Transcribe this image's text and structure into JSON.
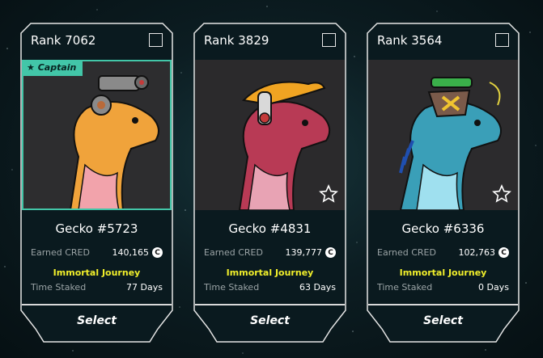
{
  "labels": {
    "earned_cred": "Earned CRED",
    "time_staked": "Time Staked",
    "select": "Select",
    "cred_icon": "C"
  },
  "colors": {
    "accent": "#42c6a8",
    "journey": "#f1ef2b",
    "card_bg": "#0a1a1f",
    "border": "#e6e6e6"
  },
  "cards": [
    {
      "rank": "Rank 7062",
      "badge": "Captain",
      "name": "Gecko #5723",
      "earned_cred": "140,165",
      "journey": "Immortal Journey",
      "time_staked": "77 Days",
      "selected": true,
      "has_star": false,
      "palette": {
        "bg": "#2d2d2f",
        "head": "#f0a33b",
        "belly": "#f2a3ab",
        "accessory": "#8a8a8a"
      }
    },
    {
      "rank": "Rank 3829",
      "name": "Gecko #4831",
      "earned_cred": "139,777",
      "journey": "Immortal Journey",
      "time_staked": "63 Days",
      "selected": false,
      "has_star": true,
      "palette": {
        "bg": "#2b2a2c",
        "head": "#b83a55",
        "belly": "#e8a3b4",
        "accessory": "#f0a422"
      }
    },
    {
      "rank": "Rank 3564",
      "name": "Gecko #6336",
      "earned_cred": "102,763",
      "journey": "Immortal Journey",
      "time_staked": "0 Days",
      "selected": false,
      "has_star": true,
      "palette": {
        "bg": "#2c2b2d",
        "head": "#3a9fb8",
        "belly": "#9fe0ef",
        "accessory": "#7a5a4a"
      }
    }
  ]
}
